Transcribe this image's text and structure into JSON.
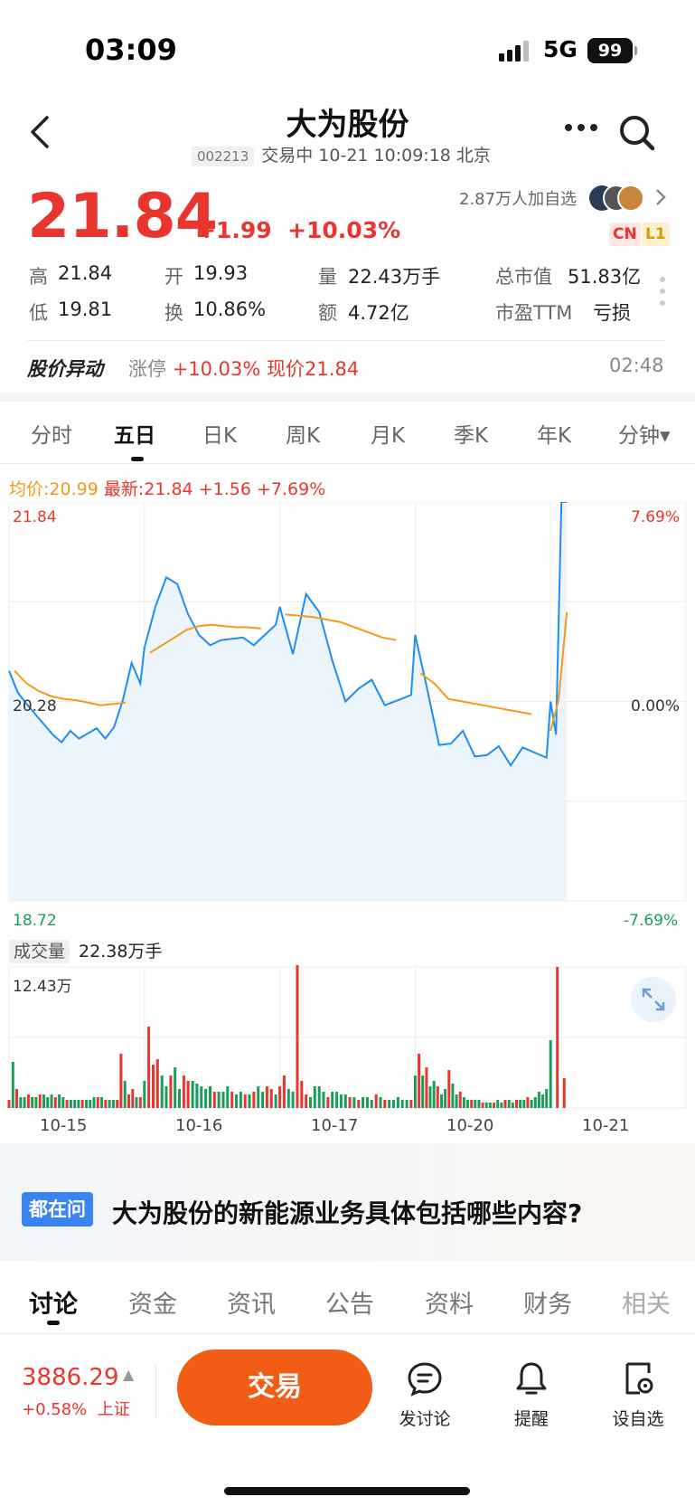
{
  "status": {
    "time": "03:09",
    "network": "5G",
    "battery": "99"
  },
  "header": {
    "title": "大为股份",
    "code": "002213",
    "status_line": "交易中 10-21 10:09:18 北京"
  },
  "quote": {
    "price": "21.84",
    "change": "+1.99",
    "change_pct": "+10.03%",
    "followers": "2.87万人加自选",
    "tag_cn": "CN",
    "tag_l1": "L1",
    "stats": {
      "high_k": "高",
      "high_v": "21.84",
      "open_k": "开",
      "open_v": "19.93",
      "vol_k": "量",
      "vol_v": "22.43万手",
      "mktcap_k": "总市值",
      "mktcap_v": "51.83亿",
      "low_k": "低",
      "low_v": "19.81",
      "turn_k": "换",
      "turn_v": "10.86%",
      "amt_k": "额",
      "amt_v": "4.72亿",
      "pe_k": "市盈TTM",
      "pe_v": "亏损"
    }
  },
  "abnormal": {
    "title": "股价异动",
    "label": "涨停",
    "pct": "+10.03%",
    "now": "现价21.84",
    "time": "02:48"
  },
  "kline_tabs": [
    "分时",
    "五日",
    "日K",
    "周K",
    "月K",
    "季K",
    "年K",
    "分钟▾"
  ],
  "legend": {
    "avg": "均价:20.99",
    "latest": "最新:21.84",
    "chg": "+1.56",
    "pct": "+7.69%"
  },
  "chart_data": {
    "type": "line",
    "title": "",
    "y_labels": {
      "top": "21.84",
      "mid": "20.28",
      "bottom": "18.72",
      "top_pct": "7.69%",
      "mid_pct": "0.00%",
      "bottom_pct": "-7.69%"
    },
    "ylim": [
      18.72,
      21.84
    ],
    "days": [
      "10-15",
      "10-16",
      "10-17",
      "10-20",
      "10-21"
    ],
    "series": [
      {
        "name": "",
        "day": "10-15",
        "price": [
          20.52,
          20.35,
          20.26,
          20.18,
          20.1,
          20.02,
          19.96,
          20.05,
          19.99,
          20.03,
          20.07,
          19.99,
          20.08,
          20.29,
          20.58,
          20.42
        ]
      },
      {
        "name": "",
        "day": "10-16",
        "price": [
          20.7,
          21.02,
          21.25,
          21.2,
          20.96,
          20.8,
          20.72,
          20.76,
          20.77,
          20.78,
          20.72,
          20.8,
          20.88
        ]
      },
      {
        "name": "",
        "day": "10-17",
        "price": [
          21.02,
          20.65,
          21.12,
          20.98,
          20.6,
          20.28,
          20.38,
          20.45,
          20.25,
          20.29,
          20.33
        ]
      },
      {
        "name": "",
        "day": "10-20",
        "price": [
          20.8,
          20.38,
          19.94,
          19.95,
          20.05,
          19.85,
          19.86,
          19.93,
          19.78,
          19.92,
          19.88,
          19.84
        ]
      },
      {
        "name": "",
        "day": "10-21",
        "price": [
          20.28,
          20.02,
          21.84,
          21.84
        ]
      }
    ],
    "avg_series": [
      [
        20.52,
        20.42,
        20.36,
        20.32,
        20.3,
        20.29,
        20.27,
        20.25,
        20.26,
        20.27
      ],
      [
        20.66,
        20.72,
        20.78,
        20.84,
        20.87,
        20.88,
        20.87,
        20.86,
        20.86,
        20.85
      ],
      [
        20.96,
        20.95,
        20.94,
        20.92,
        20.9,
        20.86,
        20.82,
        20.78,
        20.76
      ],
      [
        20.5,
        20.42,
        20.3,
        20.28,
        20.26,
        20.24,
        20.22,
        20.2,
        20.18
      ],
      [
        20.05,
        20.3,
        20.98
      ]
    ]
  },
  "volume": {
    "label": "成交量",
    "total": "22.38万手",
    "max_label": "12.43万",
    "bars": [
      [
        3,
        17,
        7,
        4,
        4,
        5,
        4,
        4,
        5,
        5,
        4,
        5,
        4,
        5,
        4,
        3,
        3,
        3,
        3,
        3,
        3,
        3,
        4,
        4,
        4,
        3,
        3,
        3,
        3,
        20,
        10,
        5,
        7,
        4,
        4
      ],
      [
        10,
        30,
        16,
        18,
        12,
        8,
        12,
        15,
        7,
        12,
        10,
        10,
        9,
        8,
        7,
        8,
        6,
        6,
        6,
        8,
        6,
        5,
        6,
        5,
        5,
        6,
        8,
        6,
        8,
        7,
        5
      ],
      [
        8,
        12,
        7,
        6,
        60,
        10,
        5,
        4,
        8,
        8,
        6,
        4,
        6,
        6,
        5,
        5,
        4,
        4,
        3,
        4,
        4,
        3,
        5,
        4,
        3,
        3,
        3,
        4,
        3,
        3,
        3
      ],
      [
        12,
        20,
        12,
        15,
        8,
        10,
        8,
        5,
        7,
        14,
        9,
        5,
        6,
        4,
        3,
        3,
        3,
        3,
        2,
        2,
        2,
        2,
        3,
        2,
        3,
        3,
        2,
        3,
        3,
        3,
        4,
        3,
        4,
        6,
        5,
        7
      ],
      [
        25,
        52,
        11
      ]
    ],
    "bar_colors": [
      [
        "r",
        "g",
        "r",
        "g",
        "g",
        "r",
        "g",
        "g",
        "r",
        "g",
        "g",
        "g",
        "r",
        "g",
        "g",
        "r",
        "g",
        "g",
        "g",
        "r",
        "g",
        "g",
        "g",
        "r",
        "g",
        "r",
        "g",
        "g",
        "r",
        "r",
        "g",
        "r",
        "r",
        "g",
        "r"
      ],
      [
        "g",
        "r",
        "r",
        "r",
        "g",
        "g",
        "r",
        "g",
        "g",
        "r",
        "r",
        "g",
        "g",
        "g",
        "g",
        "g",
        "r",
        "g",
        "g",
        "g",
        "r",
        "g",
        "g",
        "r",
        "g",
        "r",
        "g",
        "g",
        "r",
        "r",
        "g"
      ],
      [
        "r",
        "r",
        "g",
        "g",
        "r",
        "r",
        "r",
        "g",
        "g",
        "g",
        "g",
        "r",
        "g",
        "g",
        "g",
        "g",
        "r",
        "g",
        "r",
        "g",
        "g",
        "g",
        "r",
        "g",
        "r",
        "g",
        "g",
        "g",
        "g",
        "g",
        "r"
      ],
      [
        "g",
        "r",
        "g",
        "r",
        "g",
        "g",
        "r",
        "g",
        "g",
        "r",
        "g",
        "g",
        "r",
        "g",
        "g",
        "r",
        "g",
        "g",
        "r",
        "g",
        "g",
        "r",
        "g",
        "g",
        "r",
        "g",
        "g",
        "r",
        "g",
        "g",
        "r",
        "g",
        "g",
        "g",
        "g",
        "g"
      ],
      [
        "g",
        "r",
        "r"
      ]
    ]
  },
  "promo": {
    "tag": "都在问",
    "question": "大为股份的新能源业务具体包括哪些内容?"
  },
  "bottom_tabs": [
    "讨论",
    "资金",
    "资讯",
    "公告",
    "资料",
    "财务",
    "相关"
  ],
  "index": {
    "value": "3886.29",
    "chg": "+0.58%",
    "name": "上证"
  },
  "actions": {
    "trade": "交易",
    "discuss": "发讨论",
    "alert": "提醒",
    "watch": "设自选"
  },
  "colors": {
    "up": "#e8362e",
    "down": "#1a9d5c",
    "price_line": "#1f8ef0",
    "avg_line": "#f29a1a",
    "trade": "#f25c14"
  }
}
